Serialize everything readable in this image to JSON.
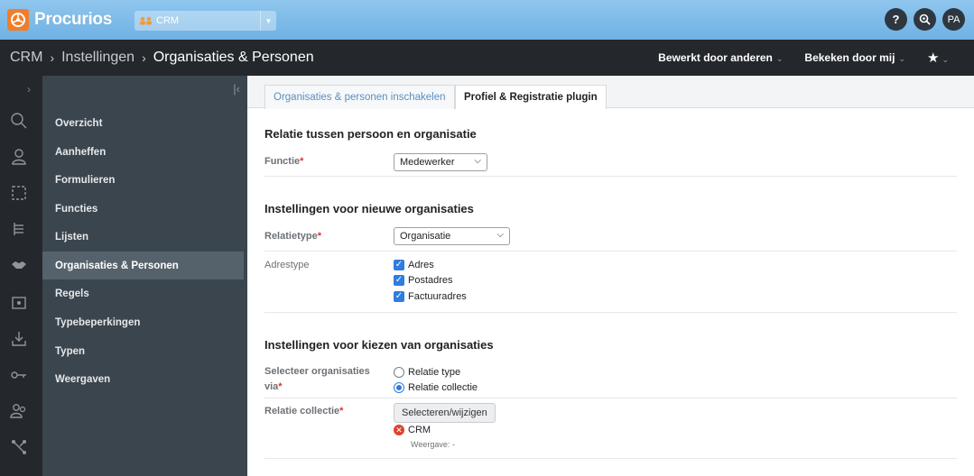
{
  "topbar": {
    "brand": "Procurios",
    "app_switcher": {
      "label": "CRM"
    },
    "help_label": "?",
    "avatar_initials": "PA"
  },
  "breadcrumb": {
    "items": [
      "CRM",
      "Instellingen",
      "Organisaties & Personen"
    ]
  },
  "header_actions": {
    "edited_by_others": "Bewerkt door anderen",
    "viewed_by_me": "Bekeken door mij"
  },
  "sidebar": {
    "items": [
      {
        "label": "Overzicht"
      },
      {
        "label": "Aanheffen"
      },
      {
        "label": "Formulieren"
      },
      {
        "label": "Functies"
      },
      {
        "label": "Lijsten"
      },
      {
        "label": "Organisaties & Personen",
        "active": true
      },
      {
        "label": "Regels"
      },
      {
        "label": "Typebeperkingen"
      },
      {
        "label": "Typen"
      },
      {
        "label": "Weergaven"
      }
    ]
  },
  "rail_icons": [
    "search-icon",
    "person-icon",
    "selection-icon",
    "hierarchy-icon",
    "handshake-icon",
    "monitor-icon",
    "download-icon",
    "key-icon",
    "users-icon",
    "connections-icon"
  ],
  "tabs": [
    {
      "label": "Organisaties & personen inschakelen",
      "active": false
    },
    {
      "label": "Profiel & Registratie plugin",
      "active": true
    }
  ],
  "sections": {
    "relation": {
      "title": "Relatie tussen persoon en organisatie",
      "functie_label": "Functie",
      "functie_value": "Medewerker"
    },
    "new_org": {
      "title": "Instellingen voor nieuwe organisaties",
      "relatietype_label": "Relatietype",
      "relatietype_value": "Organisatie",
      "adrestype_label": "Adrestype",
      "adrestype_options": [
        {
          "label": "Adres",
          "checked": true
        },
        {
          "label": "Postadres",
          "checked": true
        },
        {
          "label": "Factuuradres",
          "checked": true
        }
      ]
    },
    "choose_org": {
      "title": "Instellingen voor kiezen van organisaties",
      "via_label_line1": "Selecteer organisaties",
      "via_label_line2": "via",
      "via_options": [
        {
          "label": "Relatie type",
          "selected": false
        },
        {
          "label": "Relatie collectie",
          "selected": true
        }
      ],
      "collectie_label": "Relatie collectie",
      "select_button": "Selecteren/wijzigen",
      "selected_item": "CRM",
      "weergave": "Weergave: -"
    }
  },
  "colors": {
    "topbar": "#7ab9e8",
    "dark": "#24282c",
    "sidebar": "#3b454d",
    "active_item": "#56626b",
    "accent": "#2f7de1",
    "required": "#dd3333",
    "brand_orange": "#f07d2a"
  }
}
